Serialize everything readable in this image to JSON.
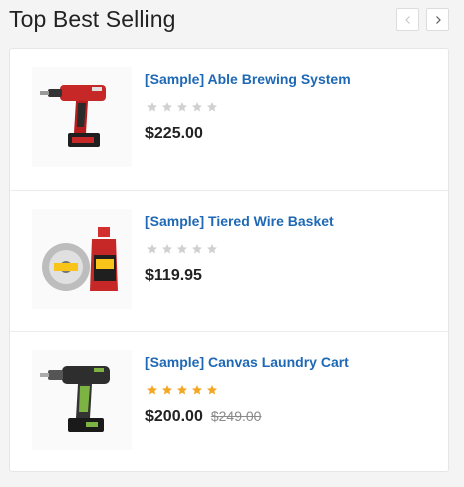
{
  "widget": {
    "title": "Top Best Selling"
  },
  "products": [
    {
      "name": "[Sample] Able Brewing System",
      "price": "$225.00",
      "old_price": "",
      "rating": 0,
      "image_icon": "cordless-drill-red-image"
    },
    {
      "name": "[Sample] Tiered Wire Basket",
      "price": "$119.95",
      "old_price": "",
      "rating": 0,
      "image_icon": "chalk-line-reel-image"
    },
    {
      "name": "[Sample] Canvas Laundry Cart",
      "price": "$200.00",
      "old_price": "$249.00",
      "rating": 5,
      "image_icon": "cordless-drill-black-image"
    }
  ],
  "colors": {
    "link": "#1e68b5",
    "star_filled": "#f5a623",
    "star_empty": "#d0d0d0"
  }
}
